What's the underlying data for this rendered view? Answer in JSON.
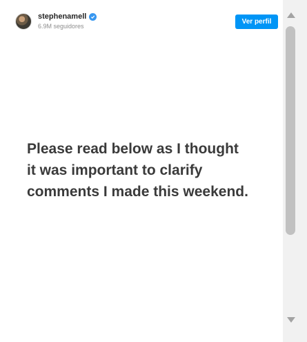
{
  "profile": {
    "username": "stephenamell",
    "followers": "6.9M seguidores",
    "verified_icon": "verified-badge-icon",
    "view_profile_label": "Ver perfil",
    "accent_color": "#0095f6"
  },
  "post": {
    "text": "Please read below as I thought\nit was important to clarify\ncomments I made this weekend."
  },
  "scrollbar": {
    "up_icon": "arrow-up-icon",
    "down_icon": "arrow-down-icon"
  }
}
